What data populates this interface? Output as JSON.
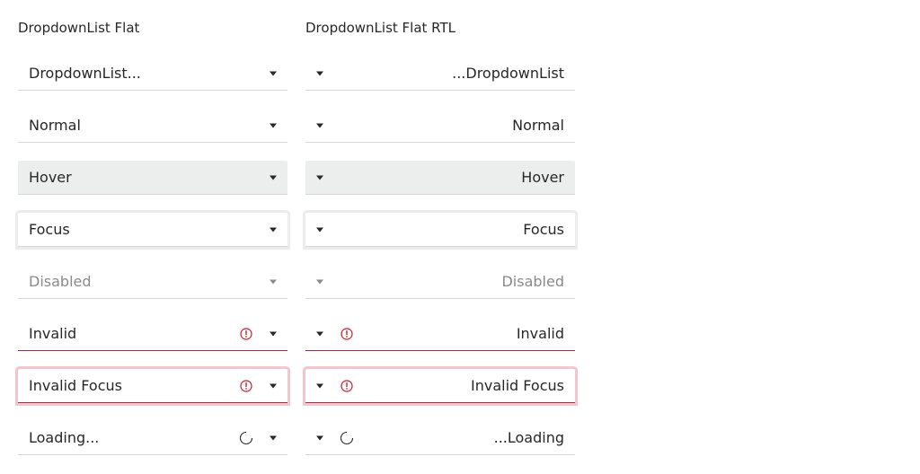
{
  "columns": [
    {
      "title": "DropdownList Flat",
      "items": [
        {
          "state": "default",
          "value": "DropdownList..."
        },
        {
          "state": "normal",
          "value": "Normal"
        },
        {
          "state": "hover",
          "value": "Hover"
        },
        {
          "state": "focus",
          "value": "Focus"
        },
        {
          "state": "disabled",
          "value": "Disabled"
        },
        {
          "state": "invalid",
          "value": "Invalid"
        },
        {
          "state": "invalid-focus",
          "value": "Invalid Focus"
        },
        {
          "state": "loading",
          "value": "Loading..."
        }
      ]
    },
    {
      "title": "DropdownList Flat RTL",
      "items": [
        {
          "state": "default",
          "value": "...DropdownList"
        },
        {
          "state": "normal",
          "value": "Normal"
        },
        {
          "state": "hover",
          "value": "Hover"
        },
        {
          "state": "focus",
          "value": "Focus"
        },
        {
          "state": "disabled",
          "value": "Disabled"
        },
        {
          "state": "invalid",
          "value": "Invalid"
        },
        {
          "state": "invalid-focus",
          "value": "Invalid Focus"
        },
        {
          "state": "loading",
          "value": "...Loading"
        }
      ]
    }
  ],
  "icons": {
    "arrow": "caret-down-icon",
    "invalid": "exclamation-circle-icon",
    "loading": "spinner-icon"
  },
  "colors": {
    "text": "#272727",
    "disabled_text": "#8a8a8a",
    "hover_bg": "#eceeed",
    "border": "#d6d6d6",
    "invalid": "#d51923",
    "invalid_border": "#a42b44",
    "invalid_focus_shadow": "#f3c5cd",
    "focus_shadow": "#ececec"
  }
}
